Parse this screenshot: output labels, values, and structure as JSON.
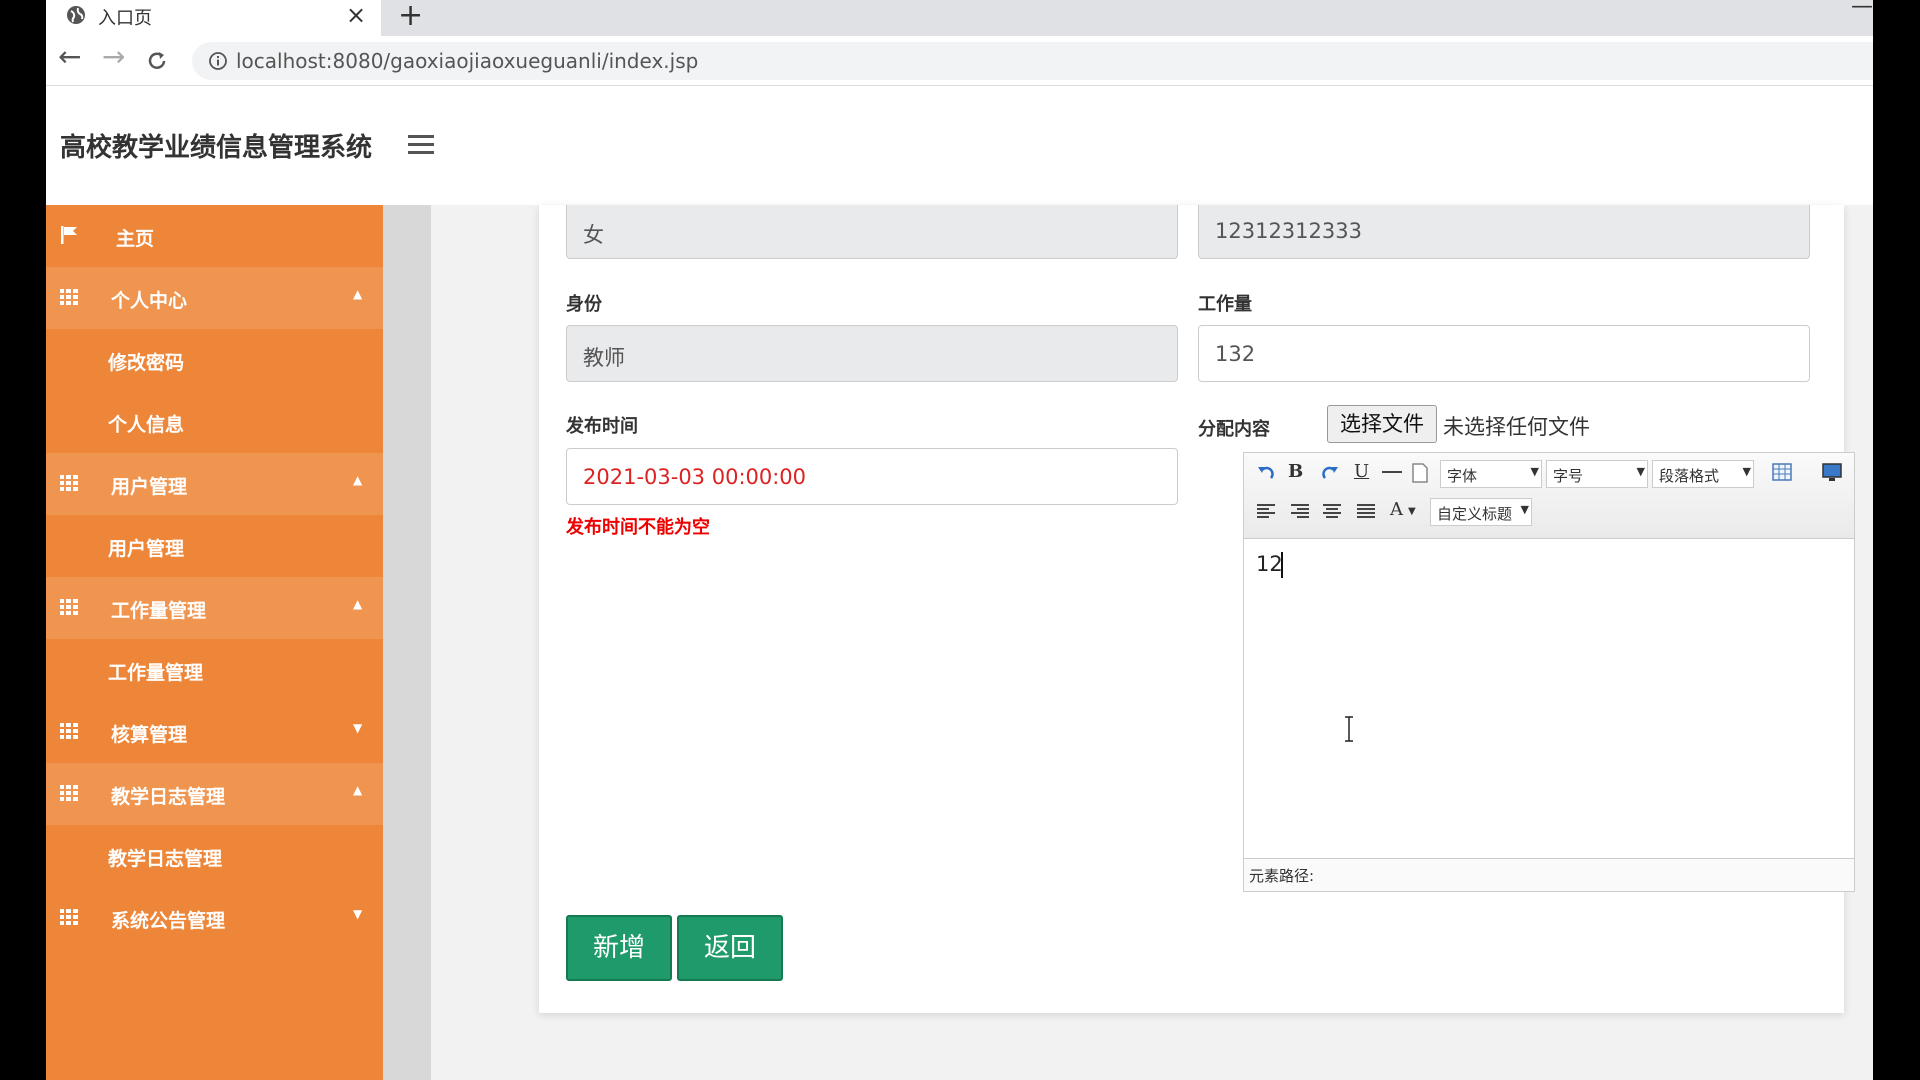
{
  "browser": {
    "tab_title": "入口页",
    "tab_close": "×",
    "new_tab": "+",
    "minimize": "—",
    "back": "←",
    "forward": "→",
    "reload": "C",
    "url": "localhost:8080/gaoxiaojiaoxueguanli/index.jsp"
  },
  "header": {
    "title": "高校教学业绩信息管理系统"
  },
  "sidebar": {
    "items": [
      {
        "label": "主页",
        "type": "home"
      },
      {
        "label": "个人中心",
        "type": "parent",
        "caret": "▲"
      },
      {
        "label": "修改密码",
        "type": "sub"
      },
      {
        "label": "个人信息",
        "type": "sub"
      },
      {
        "label": "用户管理",
        "type": "parent",
        "caret": "▲"
      },
      {
        "label": "用户管理",
        "type": "sub"
      },
      {
        "label": "工作量管理",
        "type": "parent",
        "caret": "▲"
      },
      {
        "label": "工作量管理",
        "type": "sub"
      },
      {
        "label": "核算管理",
        "type": "parent",
        "caret": "▼"
      },
      {
        "label": "教学日志管理",
        "type": "parent",
        "caret": "▲"
      },
      {
        "label": "教学日志管理",
        "type": "sub"
      },
      {
        "label": "系统公告管理",
        "type": "parent",
        "caret": "▼"
      }
    ]
  },
  "form": {
    "gender_value": "女",
    "phone_value": "12312312333",
    "identity_label": "身份",
    "identity_value": "教师",
    "workload_label": "工作量",
    "workload_value": "132",
    "publish_time_label": "发布时间",
    "publish_time_value": "2021-03-03 00:00:00",
    "publish_time_error": "发布时间不能为空",
    "content_label": "分配内容",
    "file_button": "选择文件",
    "file_status": "未选择任何文件",
    "add_button": "新增",
    "back_button": "返回"
  },
  "editor": {
    "font_select": "字体",
    "size_select": "字号",
    "paragraph_select": "段落格式",
    "custom_title_select": "自定义标题",
    "bold": "B",
    "underline": "U",
    "font_color": "A",
    "content": "12",
    "path_label": "元素路径:"
  },
  "colors": {
    "sidebar": "#ee8639",
    "sidebar_parent": "#f09550",
    "button": "#1f9a6b",
    "error": "#ee0000",
    "date_text": "#dd2222"
  }
}
